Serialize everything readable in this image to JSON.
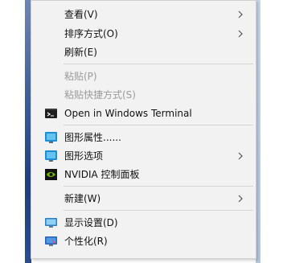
{
  "menu": {
    "items": [
      {
        "label": "查看(V)",
        "submenu": true,
        "disabled": false
      },
      {
        "label": "排序方式(O)",
        "submenu": true,
        "disabled": false
      },
      {
        "label": "刷新(E)",
        "submenu": false,
        "disabled": false
      },
      {
        "label": "粘贴(P)",
        "submenu": false,
        "disabled": true
      },
      {
        "label": "粘贴快捷方式(S)",
        "submenu": false,
        "disabled": true
      },
      {
        "label": "Open in Windows Terminal",
        "submenu": false,
        "disabled": false,
        "icon": "terminal-icon"
      },
      {
        "label": "图形属性......",
        "submenu": false,
        "disabled": false,
        "icon": "graphics-properties-icon"
      },
      {
        "label": "图形选项",
        "submenu": true,
        "disabled": false,
        "icon": "graphics-options-icon"
      },
      {
        "label": "NVIDIA 控制面板",
        "submenu": false,
        "disabled": false,
        "icon": "nvidia-icon"
      },
      {
        "label": "新建(W)",
        "submenu": true,
        "disabled": false
      },
      {
        "label": "显示设置(D)",
        "submenu": false,
        "disabled": false,
        "icon": "display-settings-icon"
      },
      {
        "label": "个性化(R)",
        "submenu": false,
        "disabled": false,
        "icon": "personalize-icon"
      }
    ]
  },
  "colors": {
    "menu_bg": "#f2f2f2",
    "separator": "#d4d4d4",
    "text": "#111111",
    "disabled_text": "#9a9a9a"
  }
}
